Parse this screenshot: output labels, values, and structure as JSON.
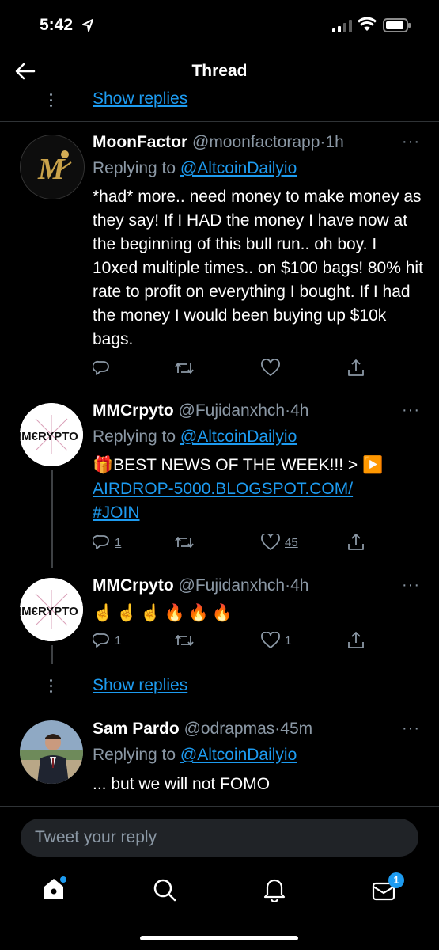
{
  "status": {
    "time": "5:42"
  },
  "nav": {
    "title": "Thread"
  },
  "top_show_replies": "Show replies",
  "tweets": [
    {
      "name": "MoonFactor",
      "handle": "@moonfactorapp",
      "dot": "·",
      "time": "1h",
      "replying_prefix": "Replying to",
      "replying_to": "@AltcoinDailyio",
      "text": "*had* more.. need money to make money as they say! If I HAD the money I have now at the beginning of this bull run.. oh boy. I 10xed multiple times.. on $100 bags! 80% hit rate to profit on everything I bought. If I had the money I would been buying up $10k bags.",
      "avatar_letter": "M"
    },
    {
      "name": "MMCrpyto",
      "handle": "@Fujidanxhch",
      "dot": "·",
      "time": "4h",
      "replying_prefix": "Replying to",
      "replying_to": "@AltcoinDailyio",
      "text_prefix": "🎁BEST NEWS OF THE WEEK!!! > ▶️",
      "link1": "AIRDROP-5000.BLOGSPOT.COM/",
      "link2": "#JOIN",
      "replies": "1",
      "likes": "45",
      "avatar_text": "IM€RYPTO"
    },
    {
      "name": "MMCrpyto",
      "handle": "@Fujidanxhch",
      "dot": "·",
      "time": "4h",
      "text": "☝️☝️☝️🔥🔥🔥",
      "replies": "1",
      "likes": "1",
      "avatar_text": "IM€RYPTO"
    },
    {
      "name": "Sam Pardo",
      "handle": "@odrapmas",
      "dot": "·",
      "time": "45m",
      "replying_prefix": "Replying to",
      "replying_to": "@AltcoinDailyio",
      "text": "... but we will not FOMO"
    }
  ],
  "mid_show_replies": "Show replies",
  "reply_box": {
    "placeholder": "Tweet your reply"
  },
  "tabbar": {
    "messages_badge": "1"
  },
  "more_glyph": "···"
}
